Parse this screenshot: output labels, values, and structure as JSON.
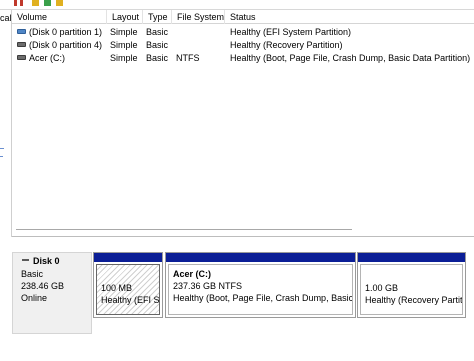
{
  "left_pane": {
    "label": "cal"
  },
  "volume_list": {
    "columns": [
      "Volume",
      "Layout",
      "Type",
      "File System",
      "Status"
    ],
    "rows": [
      {
        "icon": "disk-blue-icon",
        "volume": "(Disk 0 partition 1)",
        "layout": "Simple",
        "type": "Basic",
        "filesystem": "",
        "status": "Healthy (EFI System Partition)"
      },
      {
        "icon": "disk-gray-icon",
        "volume": "(Disk 0 partition 4)",
        "layout": "Simple",
        "type": "Basic",
        "filesystem": "",
        "status": "Healthy (Recovery Partition)"
      },
      {
        "icon": "disk-gray-icon",
        "volume": "Acer (C:)",
        "layout": "Simple",
        "type": "Basic",
        "filesystem": "NTFS",
        "status": "Healthy (Boot, Page File, Crash Dump, Basic Data Partition)"
      }
    ]
  },
  "disk": {
    "name": "Disk 0",
    "type": "Basic",
    "size": "238.46 GB",
    "state": "Online"
  },
  "partitions": [
    {
      "name": "",
      "size": "100 MB",
      "status": "Healthy (EFI Sy"
    },
    {
      "name": "Acer  (C:)",
      "size": "237.36 GB NTFS",
      "status": "Healthy (Boot, Page File, Crash Dump, Basic I"
    },
    {
      "name": "",
      "size": "1.00 GB",
      "status": "Healthy (Recovery Partit"
    }
  ],
  "colors": {
    "partition_band": "#0b1e96",
    "efi_icon": "#4f86c6"
  }
}
